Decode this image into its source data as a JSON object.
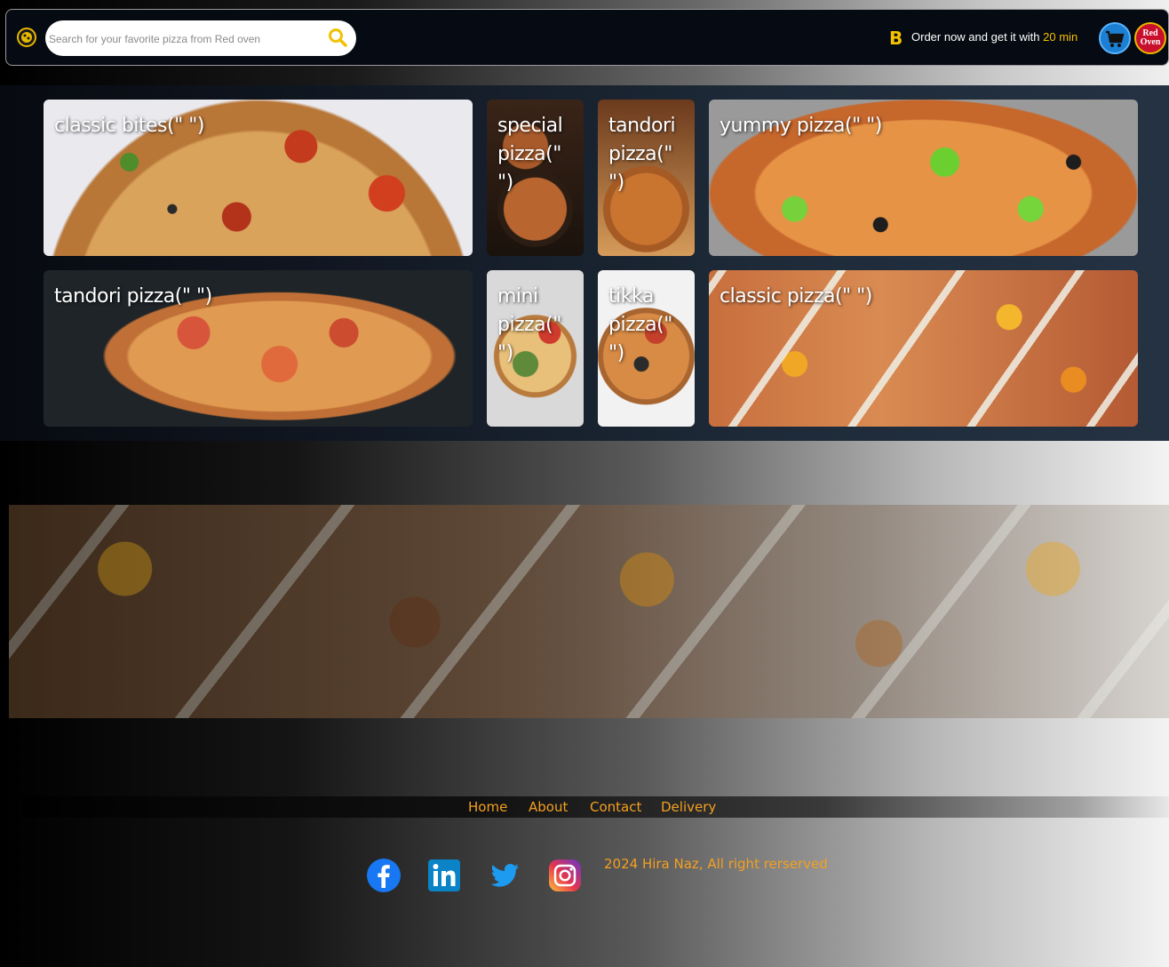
{
  "header": {
    "search_placeholder": "Search for your favorite pizza from Red oven",
    "bolt_glyph": "B",
    "order_prefix": "Order now and get it with",
    "order_highlight": "20 min",
    "brand_logo_text": "Red Oven",
    "accent_color": "#f5c000"
  },
  "gallery": {
    "cards": [
      {
        "label": "classic bites(\" \")"
      },
      {
        "label": "special pizza(\" \")"
      },
      {
        "label": "tandori pizza(\" \")"
      },
      {
        "label": "yummy pizza(\" \")"
      },
      {
        "label": "tandori pizza(\" \")"
      },
      {
        "label": "mini pizza(\" \")"
      },
      {
        "label": "tikka pizza(\" \")"
      },
      {
        "label": "classic pizza(\" \")"
      }
    ]
  },
  "footer": {
    "nav": [
      "Home",
      "About",
      "Contact",
      "Delivery"
    ],
    "social_icons": [
      "facebook-icon",
      "linkedin-icon",
      "twitter-icon",
      "instagram-icon"
    ],
    "copyright": "2024 Hira Naz, All right rerserved",
    "link_color": "#f4a020"
  }
}
